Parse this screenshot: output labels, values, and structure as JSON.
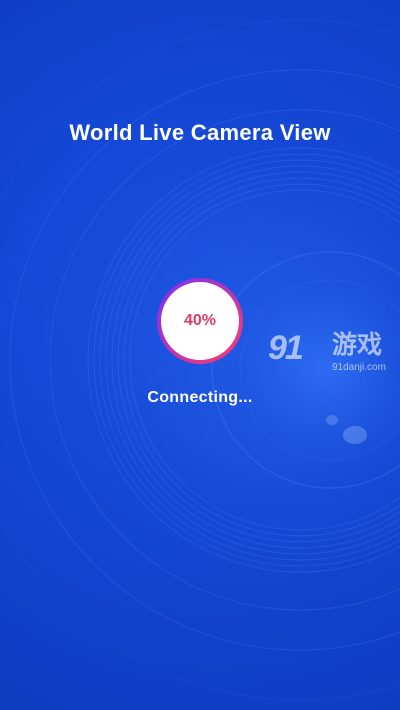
{
  "app": {
    "title": "World Live Camera View"
  },
  "progress": {
    "percent_label": "40%",
    "fraction": 0.4
  },
  "status": {
    "text": "Connecting..."
  },
  "watermark": {
    "logo": "91",
    "name": "游戏",
    "url": "91danji.com"
  },
  "colors": {
    "background": "#1448d6",
    "progress_text": "#e03b64",
    "ring_start": "#7b2ff7",
    "ring_end": "#ff3a6b"
  }
}
